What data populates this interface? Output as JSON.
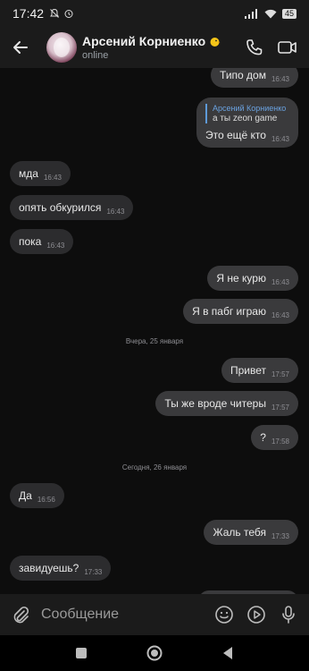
{
  "status_bar": {
    "time": "17:42",
    "battery": "45"
  },
  "header": {
    "name": "Арсений Корниенко",
    "status": "online"
  },
  "messages": [
    {
      "text": "Типо дом",
      "time": "16:43"
    },
    {
      "reply_name": "Арсений Корниенко",
      "reply_text": "а ты zeon game",
      "text": "Это ещё кто",
      "time": "16:43"
    },
    {
      "text": "мда",
      "time": "16:43"
    },
    {
      "text": "опять обкурился",
      "time": "16:43"
    },
    {
      "text": "пока",
      "time": "16:43"
    },
    {
      "text": "Я не курю",
      "time": "16:43"
    },
    {
      "text": "Я в пабг играю",
      "time": "16:43"
    },
    {
      "text": "Привет",
      "time": "17:57"
    },
    {
      "text": "Ты же вроде читеры",
      "time": "17:57"
    },
    {
      "text": "?",
      "time": "17:58"
    },
    {
      "text": "Да",
      "time": "16:56"
    },
    {
      "text": "Жаль тебя",
      "time": "17:33"
    },
    {
      "text": "завидуешь?",
      "time": "17:33"
    }
  ],
  "dates": [
    "Вчера, 25 января",
    "Сегодня, 26 января"
  ],
  "composer": {
    "placeholder": "Сообщение"
  },
  "icons": {
    "back": "arrow-left-icon",
    "call": "phone-icon",
    "video": "video-camera-icon",
    "attach": "paperclip-icon",
    "emoji": "emoji-icon",
    "play": "play-icon",
    "mic": "microphone-icon"
  }
}
